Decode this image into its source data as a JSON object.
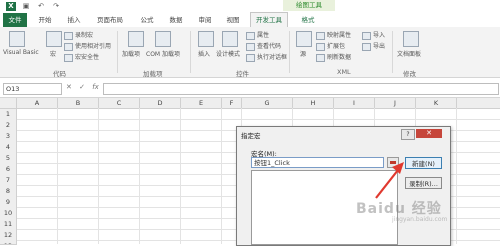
{
  "qat": {
    "save": "▣",
    "undo": "↶",
    "redo": "↷"
  },
  "titlebar": {
    "tools_label": "绘图工具"
  },
  "tabs": {
    "file": "文件",
    "home": "开始",
    "insert": "插入",
    "layout": "页面布局",
    "formula": "公式",
    "data": "数据",
    "review": "审阅",
    "view": "视图",
    "developer": "开发工具",
    "format": "格式"
  },
  "ribbon": {
    "visual_basic": "Visual Basic",
    "macros": "宏",
    "record_macro": "录制宏",
    "relative_ref": "使用相对引用",
    "macro_security": "宏安全性",
    "group_code": "代码",
    "addins": "加载项",
    "com_addins": "COM 加载项",
    "group_addins": "加载项",
    "insert": "插入",
    "design_mode": "设计模式",
    "properties": "属性",
    "view_code": "查看代码",
    "run_dialog": "执行对话框",
    "group_controls": "控件",
    "source": "源",
    "map_properties": "映射属性",
    "expansion_packs": "扩展包",
    "refresh_data": "刷新数据",
    "import": "导入",
    "export": "导出",
    "group_xml": "XML",
    "doc_panel": "文档面板",
    "group_modify": "修改"
  },
  "formula_bar": {
    "name_box": "O13",
    "cancel": "✕",
    "enter": "✓",
    "fx": "fx",
    "value": ""
  },
  "columns": [
    "A",
    "B",
    "C",
    "D",
    "E",
    "F",
    "G",
    "H",
    "I",
    "J",
    "K"
  ],
  "rows": [
    "1",
    "2",
    "3",
    "4",
    "5",
    "6",
    "7",
    "8",
    "9",
    "10",
    "11",
    "12",
    "13"
  ],
  "dialog": {
    "title": "指定宏",
    "help": "?",
    "close": "✕",
    "macro_name_label": "宏名(M):",
    "macro_name_value": "按钮1_Click",
    "new_button": "新建(N)",
    "record_button": "录制(R)..."
  },
  "watermark": {
    "text": "Baidu 经验",
    "sub": "jingyan.baidu.com"
  },
  "colors": {
    "file_tab": "#217346",
    "accent": "#217346",
    "arrow": "#e0392f",
    "close": "#c6463b"
  }
}
